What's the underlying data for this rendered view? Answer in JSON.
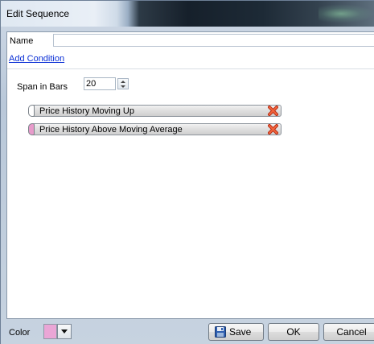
{
  "window": {
    "title": "Edit Sequence"
  },
  "form": {
    "name_label": "Name",
    "name_value": "",
    "add_condition_label": "Add Condition",
    "span_label": "Span in Bars",
    "span_value": "20"
  },
  "conditions": [
    {
      "label": "Price History Moving Up",
      "color": "#ffffff",
      "remove_icon": "red-x-icon"
    },
    {
      "label": "Price History Above Moving Average",
      "color": "#e89bcb",
      "remove_icon": "red-x-icon"
    }
  ],
  "footer": {
    "color_label": "Color",
    "color_value": "#eaa6d6",
    "save_label": "Save",
    "ok_label": "OK",
    "cancel_label": "Cancel"
  },
  "icons": {
    "save": "floppy-disk-icon",
    "remove": "red-x-icon",
    "dropdown": "chevron-down-icon"
  }
}
